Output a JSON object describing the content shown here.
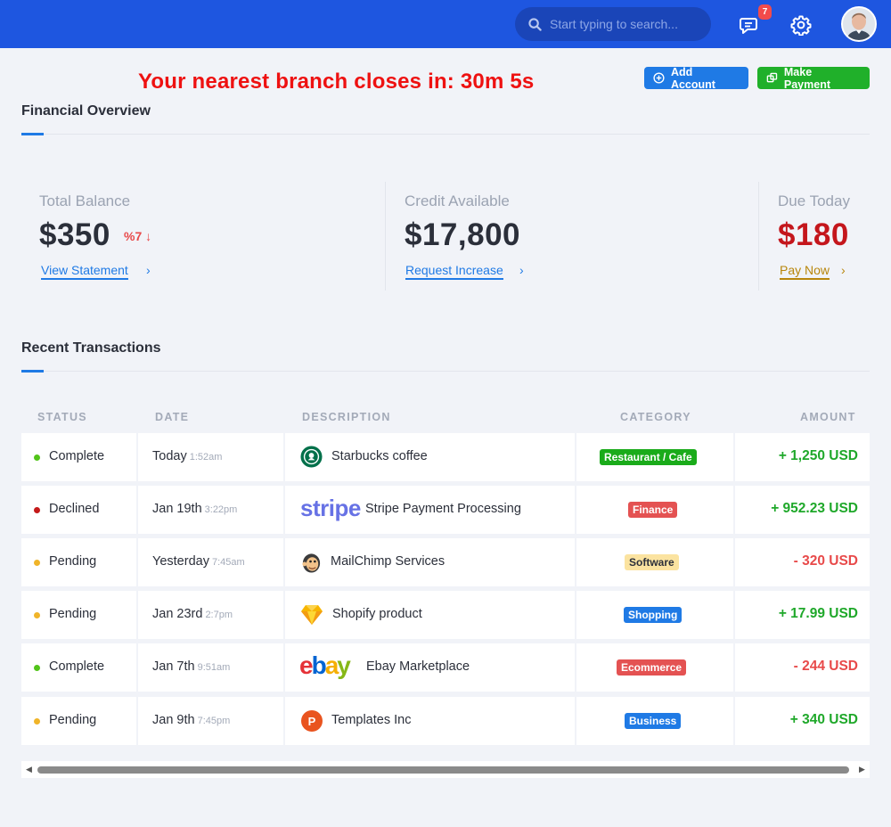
{
  "header": {
    "search_placeholder": "Start typing to search...",
    "notification_count": "7"
  },
  "banner": {
    "countdown_text": "Your nearest branch closes in: 30m 5s"
  },
  "actions": {
    "add_account_label": "Add Account",
    "make_payment_label": "Make Payment"
  },
  "overview": {
    "title": "Financial Overview",
    "stats": [
      {
        "label": "Total Balance",
        "value": "$350",
        "change": "%7",
        "change_direction": "down",
        "link": "View Statement",
        "value_color": "#2b2f3a",
        "link_color": "#1f7ae5"
      },
      {
        "label": "Credit Available",
        "value": "$17,800",
        "link": "Request Increase",
        "value_color": "#2b2f3a",
        "link_color": "#1f7ae5"
      },
      {
        "label": "Due Today",
        "value": "$180",
        "link": "Pay Now",
        "value_color": "#c4161c",
        "link_color": "#b8860b"
      }
    ]
  },
  "transactions": {
    "title": "Recent Transactions",
    "columns": [
      "STATUS",
      "DATE",
      "DESCRIPTION",
      "CATEGORY",
      "AMOUNT"
    ],
    "rows": [
      {
        "status": "Complete",
        "status_color": "#52c41a",
        "date": "Today",
        "time": "1:52am",
        "logo": "starbucks-logo",
        "description": "Starbucks coffee",
        "category": "Restaurant / Cafe",
        "category_bg": "#1aab1a",
        "category_fg": "#ffffff",
        "amount": "+ 1,250 USD",
        "amount_color": "#1fa82a"
      },
      {
        "status": "Declined",
        "status_color": "#c41a1a",
        "date": "Jan 19th",
        "time": "3:22pm",
        "logo": "stripe-logo",
        "logo_text": "stripe",
        "description": "Stripe Payment Processing",
        "category": "Finance",
        "category_bg": "#e45252",
        "category_fg": "#ffffff",
        "amount": "+ 952.23 USD",
        "amount_color": "#1fa82a"
      },
      {
        "status": "Pending",
        "status_color": "#f0b429",
        "date": "Yesterday",
        "time": "7:45am",
        "logo": "mailchimp-logo",
        "description": "MailChimp Services",
        "category": "Software",
        "category_bg": "#fbe3a0",
        "category_fg": "#2b2f3a",
        "amount": "- 320 USD",
        "amount_color": "#e84a4a"
      },
      {
        "status": "Pending",
        "status_color": "#f0b429",
        "date": "Jan 23rd",
        "time": "2:7pm",
        "logo": "shopify-logo",
        "description": "Shopify product",
        "category": "Shopping",
        "category_bg": "#1f7ae5",
        "category_fg": "#ffffff",
        "amount": "+ 17.99 USD",
        "amount_color": "#1fa82a"
      },
      {
        "status": "Complete",
        "status_color": "#52c41a",
        "date": "Jan 7th",
        "time": "9:51am",
        "logo": "ebay-logo",
        "logo_text": "ebay",
        "description": "Ebay Marketplace",
        "category": "Ecommerce",
        "category_bg": "#e45252",
        "category_fg": "#ffffff",
        "amount": "- 244 USD",
        "amount_color": "#e84a4a"
      },
      {
        "status": "Pending",
        "status_color": "#f0b429",
        "date": "Jan 9th",
        "time": "7:45pm",
        "logo": "templates-logo",
        "logo_text": "P",
        "description": "Templates Inc",
        "category": "Business",
        "category_bg": "#1f7ae5",
        "category_fg": "#ffffff",
        "amount": "+ 340 USD",
        "amount_color": "#1fa82a"
      }
    ]
  },
  "colors": {
    "topbar": "#1e56e0",
    "accent": "#1f7ae5",
    "success": "#20b02a",
    "danger": "#e84a4a"
  }
}
